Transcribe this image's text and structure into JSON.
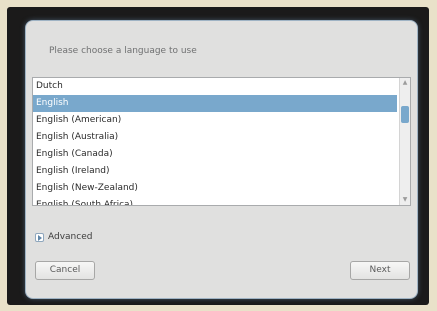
{
  "dialog": {
    "prompt": "Please choose a language to use",
    "languages": [
      "Dutch",
      "English",
      "English (American)",
      "English (Australia)",
      "English (Canada)",
      "English (Ireland)",
      "English (New-Zealand)",
      "English (South Africa)"
    ],
    "selected_index": 1,
    "advanced_label": "Advanced",
    "cancel_label": "Cancel",
    "next_label": "Next"
  },
  "colors": {
    "selection": "#79a8cc",
    "dialog_bg": "#e0e0df",
    "backdrop": "#1b1a1a"
  },
  "icons": {
    "scroll_up": "chevron-up-icon",
    "scroll_down": "chevron-down-icon",
    "expander": "triangle-right-icon"
  }
}
